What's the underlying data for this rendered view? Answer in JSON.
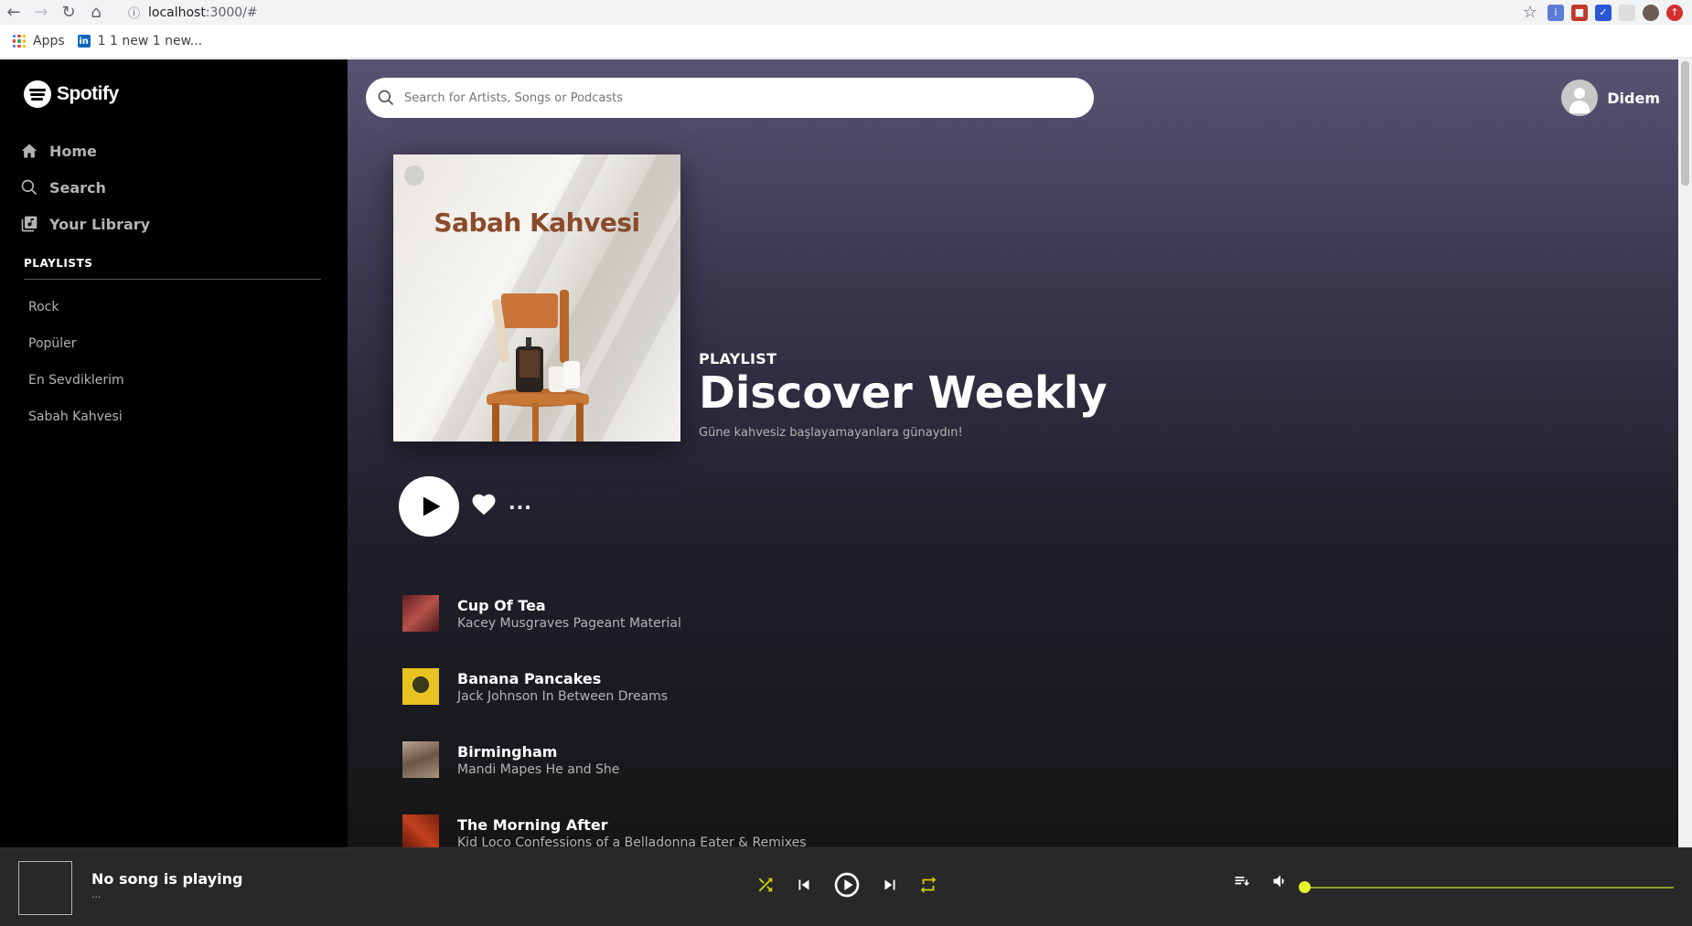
{
  "browser": {
    "url_host": "localhost",
    "url_path": ":3000/#",
    "bookmarks": [
      {
        "label": "Apps"
      },
      {
        "label": "1 1 new 1 new..."
      }
    ]
  },
  "sidebar": {
    "logo_text": "Spotify",
    "nav": [
      {
        "label": "Home",
        "icon": "home-icon"
      },
      {
        "label": "Search",
        "icon": "search-icon"
      },
      {
        "label": "Your Library",
        "icon": "library-icon"
      }
    ],
    "playlists_title": "PLAYLISTS",
    "playlists": [
      "Rock",
      "Popüler",
      "En Sevdiklerim",
      "Sabah Kahvesi"
    ]
  },
  "search": {
    "placeholder": "Search for Artists, Songs or Podcasts"
  },
  "user": {
    "name": "Didem"
  },
  "playlist": {
    "cover_text": "Sabah Kahvesi",
    "type": "PLAYLIST",
    "name": "Discover Weekly",
    "description": "Güne kahvesiz başlayamayanlara günaydın!"
  },
  "tracks": [
    {
      "title": "Cup Of Tea",
      "subtitle": "Kacey Musgraves Pageant Material",
      "art_color": "#8b3a3a"
    },
    {
      "title": "Banana Pancakes",
      "subtitle": "Jack Johnson In Between Dreams",
      "art_color": "#e8c320"
    },
    {
      "title": "Birmingham",
      "subtitle": "Mandi Mapes He and She",
      "art_color": "#8a7462"
    },
    {
      "title": "The Morning After",
      "subtitle": "Kid Loco Confessions of a Belladonna Eater & Remixes",
      "art_color": "#9c2a1a"
    }
  ],
  "player": {
    "title": "No song is playing",
    "subtitle": "...",
    "accent": "#c8d300",
    "volume": 0
  }
}
